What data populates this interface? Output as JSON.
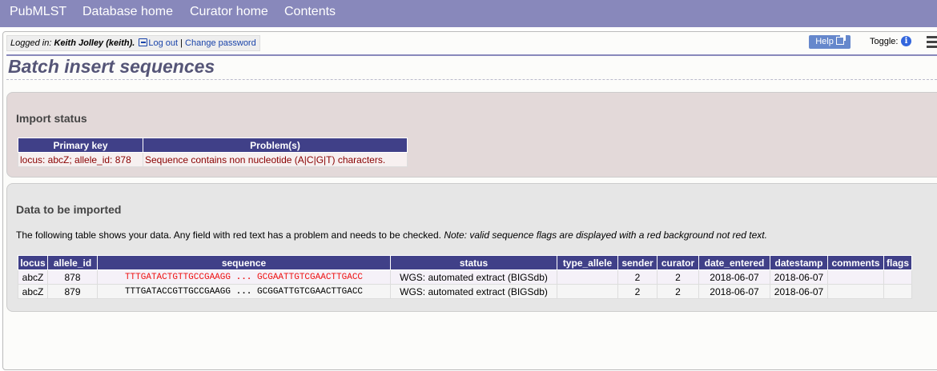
{
  "nav": {
    "items": [
      "PubMLST",
      "Database home",
      "Curator home",
      "Contents"
    ]
  },
  "userbar": {
    "prefix": "Logged in: ",
    "user": "Keith Jolley (keith).",
    "logout": "Log out",
    "separator": " | ",
    "change_password": "Change password"
  },
  "help": {
    "label": "Help"
  },
  "toggle": {
    "label": "Toggle:"
  },
  "page": {
    "title": "Batch insert sequences"
  },
  "import_status": {
    "heading": "Import status",
    "headers": [
      "Primary key",
      "Problem(s)"
    ],
    "rows": [
      [
        "locus: abcZ; allele_id: 878",
        "Sequence contains non nucleotide (A|C|G|T) characters."
      ]
    ]
  },
  "data_import": {
    "heading": "Data to be imported",
    "desc_plain": "The following table shows your data. Any field with red text has a problem and needs to be checked. ",
    "desc_italic": "Note: valid sequence flags are displayed with a red background not red text.",
    "headers": [
      "locus",
      "allele_id",
      "sequence",
      "status",
      "type_allele",
      "sender",
      "curator",
      "date_entered",
      "datestamp",
      "comments",
      "flags"
    ],
    "rows": [
      {
        "locus": "abcZ",
        "allele_id": "878",
        "seq_start": "TTTGATACTGTTGCCGAAGG",
        "seq_ellipsis": "...",
        "seq_end": "GCGAATTGTCGAACTTGACC",
        "status": "WGS: automated extract (BIGSdb)",
        "type_allele": "",
        "sender": "2",
        "curator": "2",
        "date_entered": "2018-06-07",
        "datestamp": "2018-06-07",
        "comments": "",
        "flags": ""
      },
      {
        "locus": "abcZ",
        "allele_id": "879",
        "seq_start": "TTTGATACCGTTGCCGAAGG",
        "seq_ellipsis": "...",
        "seq_end": "GCGGATTGTCGAACTTGACC",
        "status": "WGS: automated extract (BIGSdb)",
        "type_allele": "",
        "sender": "2",
        "curator": "2",
        "date_entered": "2018-06-07",
        "datestamp": "2018-06-07",
        "comments": "",
        "flags": ""
      }
    ]
  },
  "colors": {
    "nav_bg": "#8888bb",
    "table_header": "#404088",
    "error_text": "#ee1111",
    "status_panel": "#e3d9d9"
  }
}
